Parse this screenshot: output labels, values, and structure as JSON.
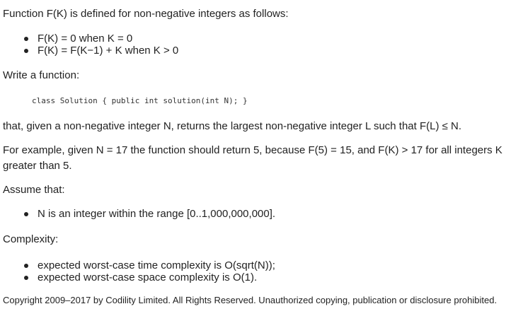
{
  "intro": "Function F(K) is defined for non-negative integers as follows:",
  "definition_items": [
    "F(K) = 0 when K = 0",
    "F(K) = F(K−1) + K when K > 0"
  ],
  "write_function": "Write a function:",
  "code": "class Solution { public int solution(int N); }",
  "returns": "that, given a non-negative integer N, returns the largest non-negative integer L such that F(L) ≤ N.",
  "example": "For example, given N = 17 the function should return 5, because F(5) = 15, and F(K) > 17 for all integers K greater than 5.",
  "assume": "Assume that:",
  "assumption_items": [
    "N is an integer within the range [0..1,000,000,000]."
  ],
  "complexity_heading": "Complexity:",
  "complexity_items": [
    "expected worst-case time complexity is O(sqrt(N));",
    "expected worst-case space complexity is O(1)."
  ],
  "copyright": "Copyright 2009–2017 by Codility Limited. All Rights Reserved. Unauthorized copying, publication or disclosure prohibited."
}
